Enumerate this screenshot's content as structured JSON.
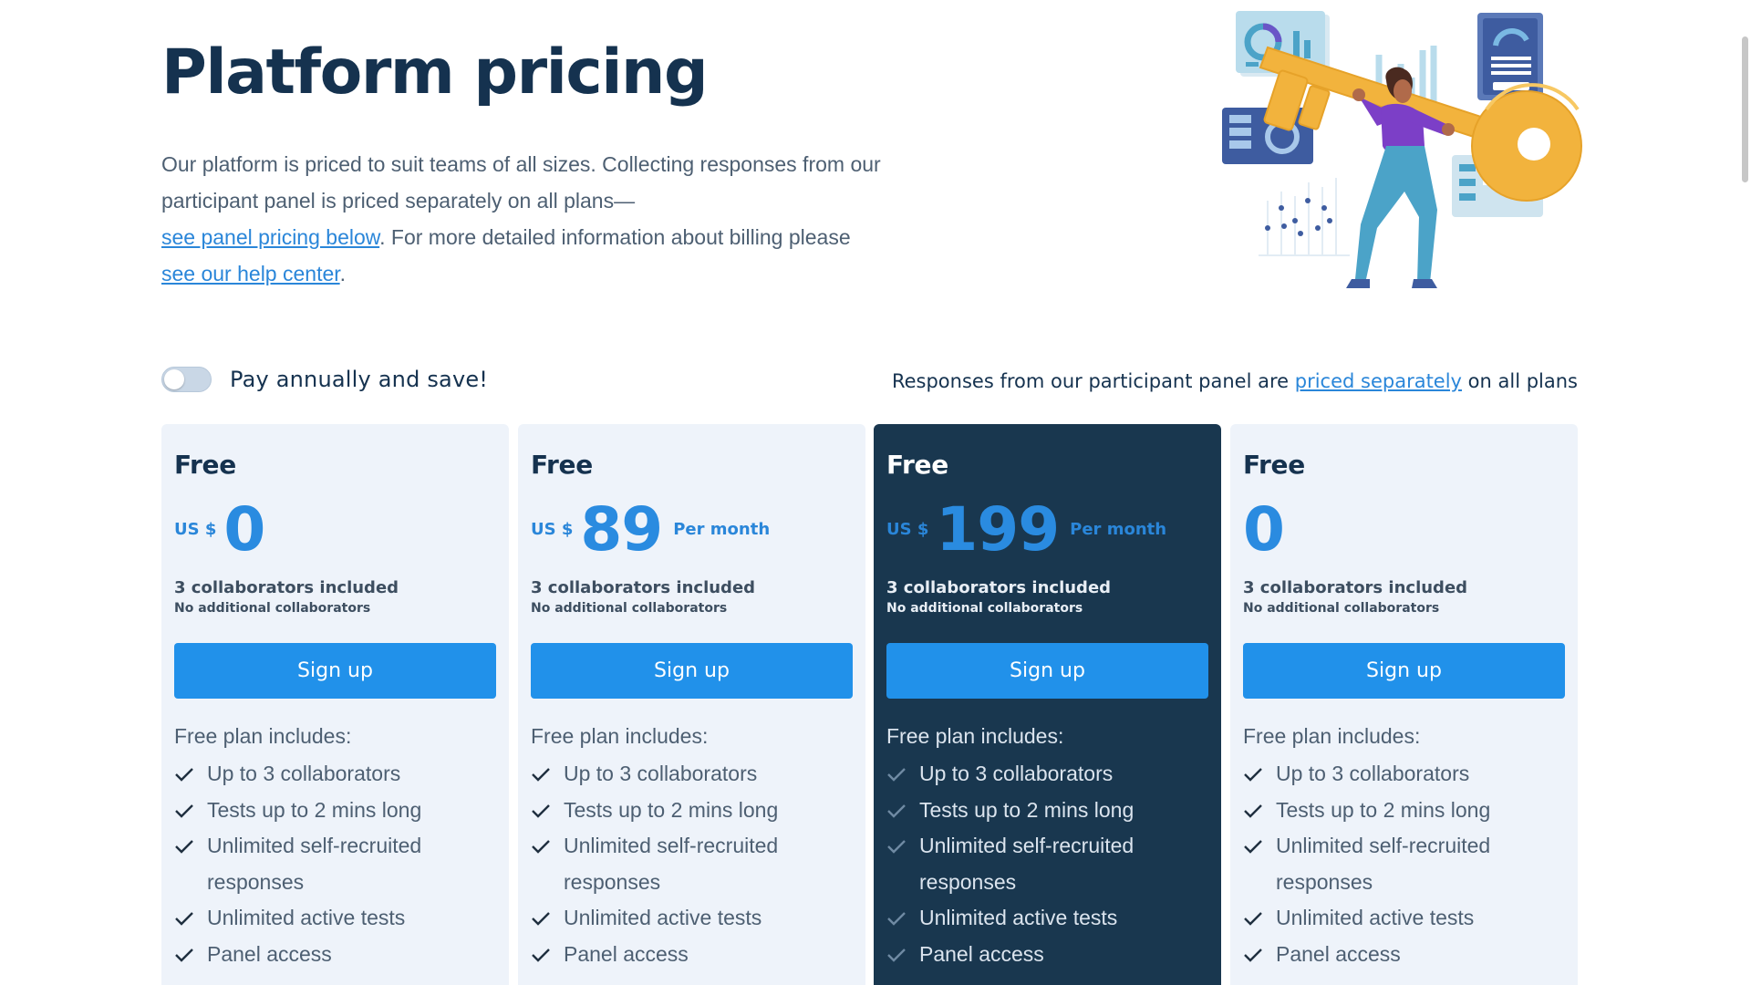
{
  "header": {
    "title": "Platform pricing",
    "intro_1": "Our platform is priced to suit teams of all sizes. Collecting responses from our participant panel is priced separately on all plans—",
    "intro_link_1": "see panel pricing below",
    "intro_2": ". For more detailed information about billing please ",
    "intro_link_2": "see our help center",
    "intro_3": "."
  },
  "billing": {
    "toggle_label": "Pay annually and save!",
    "toggle_on": false,
    "note_prefix": "Responses from our participant panel are ",
    "note_link": "priced separately",
    "note_suffix": " on all plans"
  },
  "plans": [
    {
      "name": "Free",
      "currency": "US $",
      "amount": "0",
      "period": "",
      "collaborators": "3 collaborators included",
      "collaborators_note": "No additional collaborators",
      "cta": "Sign up",
      "includes_label": "Free plan includes:",
      "features": [
        "Up to 3 collaborators",
        "Tests up to 2 mins long",
        "Unlimited self-recruited responses",
        "Unlimited active tests",
        "Panel access"
      ]
    },
    {
      "name": "Free",
      "currency": "US $",
      "amount": "89",
      "period": "Per month",
      "collaborators": "3 collaborators included",
      "collaborators_note": "No additional collaborators",
      "cta": "Sign up",
      "includes_label": "Free plan includes:",
      "features": [
        "Up to 3 collaborators",
        "Tests up to 2 mins long",
        "Unlimited self-recruited responses",
        "Unlimited active tests",
        "Panel access"
      ]
    },
    {
      "name": "Free",
      "currency": "US $",
      "amount": "199",
      "period": "Per month",
      "collaborators": "3 collaborators included",
      "collaborators_note": "No additional collaborators",
      "cta": "Sign up",
      "includes_label": "Free plan includes:",
      "features": [
        "Up to 3 collaborators",
        "Tests up to 2 mins long",
        "Unlimited self-recruited responses",
        "Unlimited active tests",
        "Panel access"
      ]
    },
    {
      "name": "Free",
      "currency": "",
      "amount": "0",
      "period": "",
      "collaborators": "3 collaborators included",
      "collaborators_note": "No additional collaborators",
      "cta": "Sign up",
      "includes_label": "Free plan includes:",
      "features": [
        "Up to 3 collaborators",
        "Tests up to 2 mins long",
        "Unlimited self-recruited responses",
        "Unlimited active tests",
        "Panel access"
      ]
    }
  ],
  "colors": {
    "heading": "#15324f",
    "accent": "#2191ea",
    "card_bg": "#eef3fa",
    "featured_card_bg": "#19374f"
  },
  "icons": {
    "feature_check": "check-icon",
    "illustration": "key-illustration"
  }
}
